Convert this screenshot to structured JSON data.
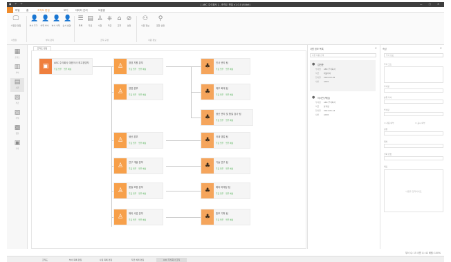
{
  "window": {
    "title": "[ ABC 주식회사 ] - 조직도 편집 v1.0.0 (64bit)",
    "controls": [
      "—",
      "□",
      "✕"
    ]
  },
  "menu": {
    "tabs": [
      "파일",
      "홈",
      "조직도 편집",
      "보기",
      "데이터 관리",
      "도움말"
    ],
    "active_index": 2
  },
  "ribbon": {
    "buttons": [
      {
        "label": "사업장 편집",
        "icon": "building-icon"
      },
      {
        "label": "부서 추가",
        "icon": "person-icon"
      },
      {
        "label": "하위 부서",
        "icon": "person-icon"
      },
      {
        "label": "부서 삭제",
        "icon": "person-icon"
      },
      {
        "label": "순서 변경",
        "icon": "person-icon"
      },
      {
        "label": "목록",
        "icon": "list-icon"
      },
      {
        "label": "자료",
        "icon": "doc-icon"
      },
      {
        "label": "사원",
        "icon": "person-icon"
      },
      {
        "label": "직급",
        "icon": "chart-icon"
      },
      {
        "label": "조회",
        "icon": "search-icon"
      },
      {
        "label": "설정",
        "icon": "gear-icon"
      },
      {
        "label": "사원 정보",
        "icon": "users-icon"
      },
      {
        "label": "권한 설정",
        "icon": "key-icon"
      }
    ],
    "groups": [
      "사업장",
      "부서 관리",
      "조직 구성",
      "사원 정보"
    ]
  },
  "sidebar": {
    "items": [
      {
        "label": "조직도",
        "icon": "org-icon"
      },
      {
        "label": "부서",
        "icon": "dept-icon"
      },
      {
        "label": "사원",
        "icon": "user-icon"
      },
      {
        "label": "직급",
        "icon": "rank-icon"
      },
      {
        "label": "직책",
        "icon": "title-icon"
      },
      {
        "label": "권한",
        "icon": "lock-icon"
      },
      {
        "label": "기록",
        "icon": "log-icon"
      }
    ],
    "active_index": 2
  },
  "document_tab": "조직도 편집",
  "org": {
    "status_a": "주요 업무",
    "status_b": "업무 배정",
    "head": "ABC 주식회사 대표이사 최고경영자",
    "departments": [
      "경영 지원 본부",
      "영업 본부",
      "생산 본부",
      "연구 개발 본부",
      "품질 보증 본부",
      "해외 사업 본부",
      "마케팅 본부"
    ],
    "teams": [
      "인사 관리 팀",
      "재무 회계 팀",
      "생산 관리 및 품질 검사 팀",
      "국내 영업 팀",
      "기술 연구 팀",
      "해외 마케팅 팀",
      "홍보 기획 팀"
    ]
  },
  "employee_panel": {
    "title": "사원 정보 목록",
    "search_placeholder": "사원 이름 검색",
    "cards": [
      {
        "name": "김민준",
        "rows": [
          [
            "부서명",
            "ABC 주식회사"
          ],
          [
            "직급",
            "대표이사"
          ],
          [
            "입사일",
            "2010-03-02"
          ],
          [
            "사번",
            "A001"
          ]
        ]
      },
      {
        "name": "이서연 (책임)",
        "rows": [
          [
            "부서명",
            "ABC 주식회사"
          ],
          [
            "직급",
            "본부장"
          ],
          [
            "입사일",
            "2012-05-14"
          ],
          [
            "사번",
            "A002"
          ]
        ]
      }
    ]
  },
  "property_panel": {
    "title": "속성",
    "tab": "부서 정보",
    "fields": [
      "부서 코드",
      "부서명",
      "상위 부서",
      "부서장",
      "정원",
      "위치",
      "전화 번호",
      "메모"
    ],
    "checkbox_a": "사용 여부",
    "checkbox_b": "표시 여부",
    "empty_text": "내용을 입력하세요"
  },
  "statusbar": {
    "text": "부서 수: 15   사원 수: 42   배율: 100%"
  },
  "bottom_tabs": [
    "조직도",
    "부서 목록 편집",
    "사원 목록 편집",
    "직급 체계 편집",
    "ABC 주식회사 조직"
  ]
}
